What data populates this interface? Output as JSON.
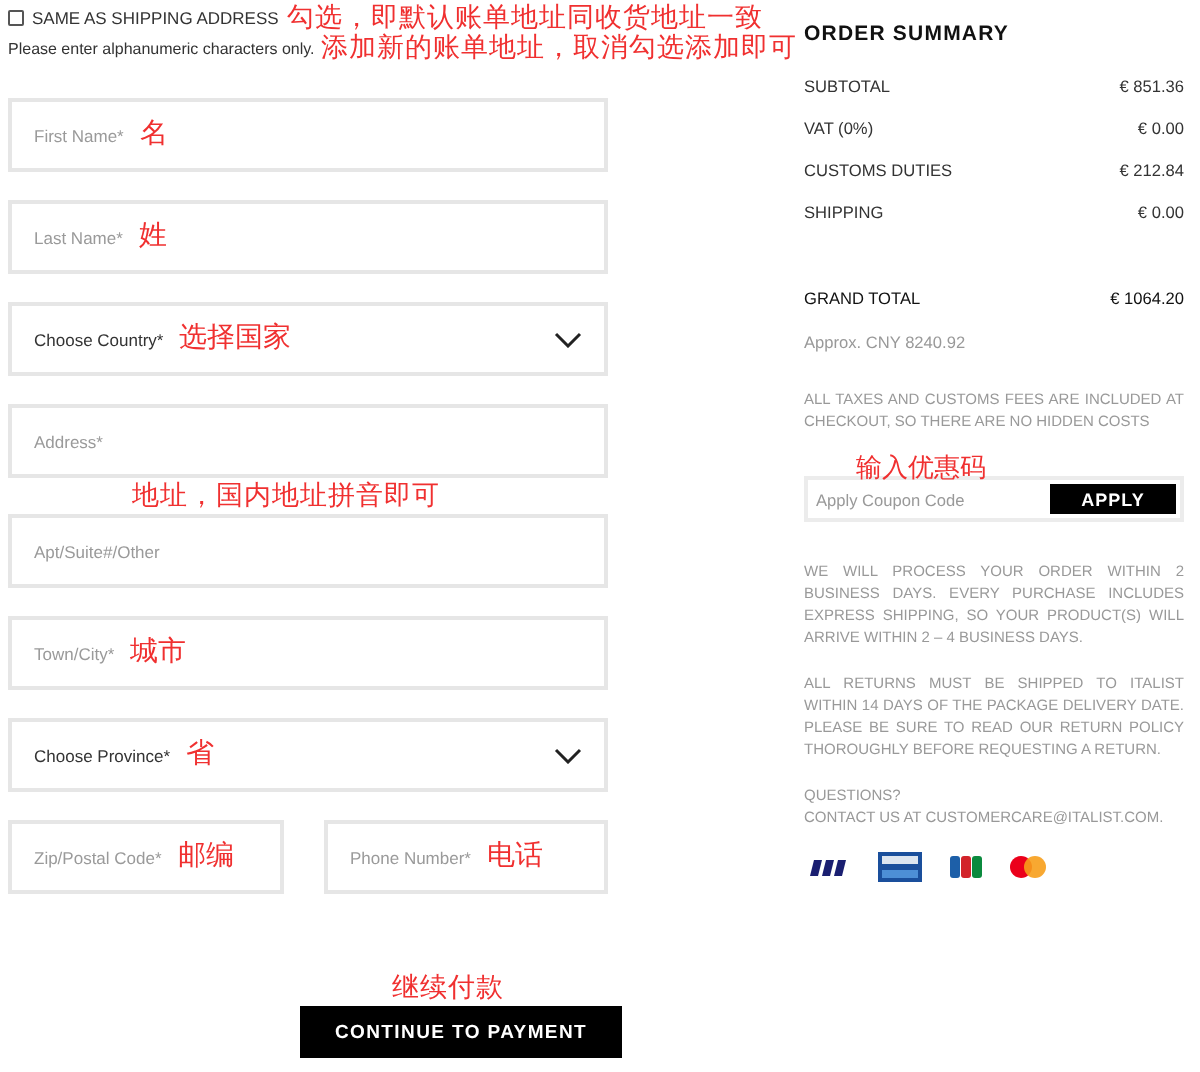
{
  "same_as_shipping": {
    "label": "SAME AS SHIPPING ADDRESS",
    "checked": false,
    "annotation": "勾选，即默认账单地址同收货地址一致"
  },
  "hint": {
    "text": "Please enter alphanumeric characters only.",
    "annotation": "添加新的账单地址，取消勾选添加即可"
  },
  "fields": [
    {
      "kind": "input",
      "placeholder": "First Name*",
      "annotation": "名"
    },
    {
      "kind": "input",
      "placeholder": "Last Name*",
      "annotation": "姓"
    },
    {
      "kind": "select",
      "label": "Choose Country*",
      "annotation": "选择国家"
    },
    {
      "kind": "input",
      "placeholder": "Address*",
      "note_below": "地址，国内地址拼音即可"
    },
    {
      "kind": "input",
      "placeholder": "Apt/Suite#/Other"
    },
    {
      "kind": "input",
      "placeholder": "Town/City*",
      "annotation": "城市"
    },
    {
      "kind": "select",
      "label": "Choose Province*",
      "annotation": "省"
    },
    {
      "kind": "pair",
      "fields": [
        {
          "kind": "input",
          "placeholder": "Zip/Postal Code*",
          "annotation": "邮编"
        },
        {
          "kind": "input",
          "placeholder": "Phone Number*",
          "annotation": "电话"
        }
      ]
    }
  ],
  "continue_button": {
    "label": "CONTINUE TO PAYMENT",
    "annotation": "继续付款"
  },
  "summary": {
    "title": "ORDER SUMMARY",
    "rows": [
      {
        "label": "SUBTOTAL",
        "value": "€ 851.36"
      },
      {
        "label": "VAT (0%)",
        "value": "€ 0.00"
      },
      {
        "label": "CUSTOMS DUTIES",
        "value": "€ 212.84"
      },
      {
        "label": "SHIPPING",
        "value": "€ 0.00"
      }
    ],
    "grand_total": {
      "label": "GRAND TOTAL",
      "value": "€ 1064.20"
    },
    "approx": "Approx. CNY 8240.92",
    "tax_note": "ALL TAXES AND CUSTOMS FEES ARE INCLUDED AT CHECKOUT, SO THERE ARE NO HIDDEN COSTS",
    "coupon": {
      "placeholder": "Apply Coupon Code",
      "button": "APPLY",
      "annotation": "输入优惠码"
    },
    "processing_note": "WE WILL PROCESS YOUR ORDER WITHIN 2 BUSINESS DAYS. EVERY PURCHASE INCLUDES EXPRESS SHIPPING, SO YOUR PRODUCT(S) WILL ARRIVE WITHIN 2 – 4 BUSINESS DAYS.",
    "returns_note": "ALL RETURNS MUST BE SHIPPED TO ITALIST WITHIN 14 DAYS OF THE PACKAGE DELIVERY DATE. PLEASE BE SURE TO READ OUR RETURN POLICY THOROUGHLY BEFORE REQUESTING A RETURN.",
    "questions": "QUESTIONS?",
    "contact": "CONTACT US AT CUSTOMERCARE@ITALIST.COM."
  }
}
